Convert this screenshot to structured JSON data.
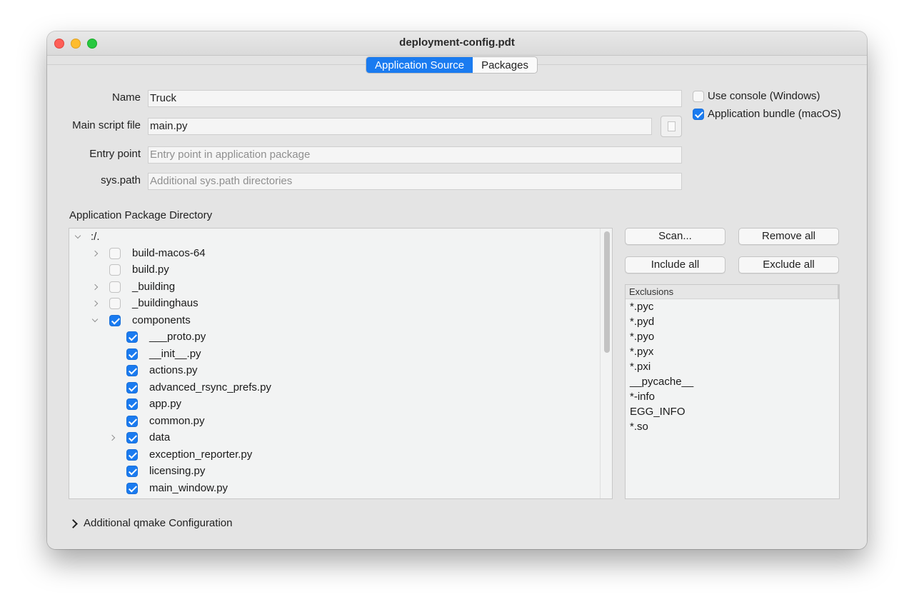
{
  "window": {
    "title": "deployment-config.pdt"
  },
  "tabs": [
    {
      "label": "Application Source",
      "active": true
    },
    {
      "label": "Packages",
      "active": false
    }
  ],
  "form": {
    "name": {
      "label": "Name",
      "value": "Truck"
    },
    "main_script": {
      "label": "Main script file",
      "value": "main.py"
    },
    "entry_point": {
      "label": "Entry point",
      "placeholder": "Entry point in application package"
    },
    "sys_path": {
      "label": "sys.path",
      "placeholder": "Additional sys.path directories"
    }
  },
  "options": {
    "use_console": {
      "label": "Use console (Windows)",
      "checked": false
    },
    "app_bundle": {
      "label": "Application bundle (macOS)",
      "checked": true
    }
  },
  "package_dir": {
    "title": "Application Package Directory",
    "root": ":/.",
    "items": [
      {
        "label": "build-macos-64",
        "checked": false,
        "expandable": true,
        "level": 1
      },
      {
        "label": "build.py",
        "checked": false,
        "expandable": false,
        "level": 1
      },
      {
        "label": "_building",
        "checked": false,
        "expandable": true,
        "level": 1
      },
      {
        "label": "_buildinghaus",
        "checked": false,
        "expandable": true,
        "level": 1
      },
      {
        "label": "components",
        "checked": true,
        "expanded": true,
        "level": 1
      },
      {
        "label": "___proto.py",
        "checked": true,
        "level": 2
      },
      {
        "label": "__init__.py",
        "checked": true,
        "level": 2
      },
      {
        "label": "actions.py",
        "checked": true,
        "level": 2
      },
      {
        "label": "advanced_rsync_prefs.py",
        "checked": true,
        "level": 2
      },
      {
        "label": "app.py",
        "checked": true,
        "level": 2
      },
      {
        "label": "common.py",
        "checked": true,
        "level": 2
      },
      {
        "label": "data",
        "checked": true,
        "expandable": true,
        "level": 2
      },
      {
        "label": "exception_reporter.py",
        "checked": true,
        "level": 2
      },
      {
        "label": "licensing.py",
        "checked": true,
        "level": 2
      },
      {
        "label": "main_window.py",
        "checked": true,
        "level": 2
      }
    ]
  },
  "actions": {
    "scan": "Scan...",
    "remove_all": "Remove all",
    "include_all": "Include all",
    "exclude_all": "Exclude all"
  },
  "exclusions": {
    "header": "Exclusions",
    "items": [
      "*.pyc",
      "*.pyd",
      "*.pyo",
      "*.pyx",
      "*.pxi",
      "__pycache__",
      "*-info",
      "EGG_INFO",
      "*.so"
    ]
  },
  "qmake": {
    "label": "Additional qmake Configuration"
  },
  "colors": {
    "accent": "#1a7bf0"
  }
}
